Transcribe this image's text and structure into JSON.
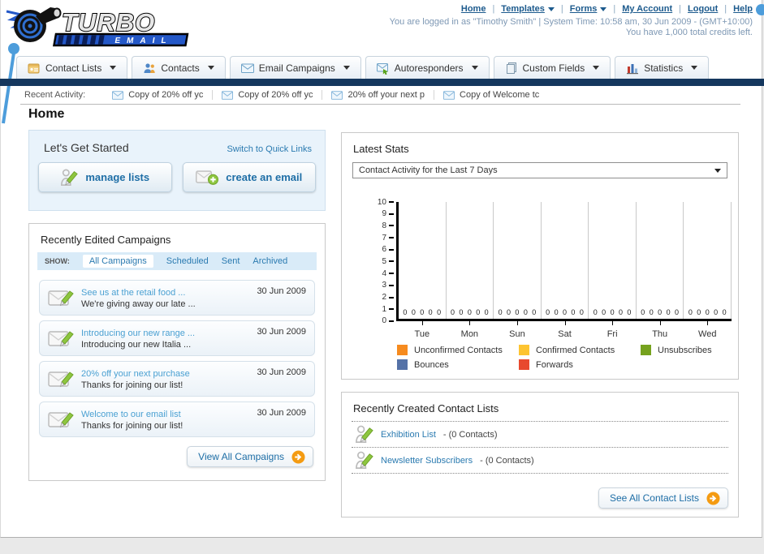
{
  "header": {
    "logo_title": "TURBO",
    "logo_subtitle": "EMAIL",
    "nav_links": [
      {
        "label": "Home",
        "dropdown": false
      },
      {
        "label": "Templates",
        "dropdown": true
      },
      {
        "label": "Forms",
        "dropdown": true
      },
      {
        "label": "My Account",
        "dropdown": false
      },
      {
        "label": "Logout",
        "dropdown": false
      },
      {
        "label": "Help",
        "dropdown": false
      }
    ],
    "login_status": "You are logged in as \"Timothy Smith\" | System Time: 10:58 am, 30 Jun 2009 - (GMT+10:00)",
    "credits": "You have 1,000 total credits left."
  },
  "nav_tabs": [
    {
      "label": "Contact Lists"
    },
    {
      "label": "Contacts"
    },
    {
      "label": "Email Campaigns"
    },
    {
      "label": "Autoresponders"
    },
    {
      "label": "Custom Fields"
    },
    {
      "label": "Statistics"
    }
  ],
  "recent_activity": {
    "label": "Recent Activity:",
    "items": [
      "Copy of 20% off yc",
      "Copy of 20% off yc",
      "20% off your next p",
      "Copy of Welcome tc"
    ]
  },
  "page_title": "Home",
  "get_started": {
    "title": "Let's Get Started",
    "switch_link": "Switch to Quick Links",
    "buttons": [
      {
        "label": "manage lists"
      },
      {
        "label": "create an email"
      }
    ]
  },
  "campaigns": {
    "title": "Recently Edited Campaigns",
    "show_label": "SHOW:",
    "filters": [
      "All Campaigns",
      "Scheduled",
      "Sent",
      "Archived"
    ],
    "items": [
      {
        "title": "See us at the retail food ...",
        "subtitle": "We're giving away our late ...",
        "date": "30 Jun 2009"
      },
      {
        "title": "Introducing our new range ...",
        "subtitle": "Introducing our new Italia ...",
        "date": "30 Jun 2009"
      },
      {
        "title": "20% off your next purchase",
        "subtitle": "Thanks for joining our list!",
        "date": "30 Jun 2009"
      },
      {
        "title": "Welcome to our email list",
        "subtitle": "Thanks for joining our list!",
        "date": "30 Jun 2009"
      }
    ],
    "view_all_label": "View All Campaigns"
  },
  "stats": {
    "title": "Latest Stats",
    "dropdown_value": "Contact Activity for the Last 7 Days"
  },
  "chart_data": {
    "type": "bar",
    "title": "Contact Activity for the Last 7 Days",
    "categories": [
      "Tue",
      "Mon",
      "Sun",
      "Sat",
      "Fri",
      "Thu",
      "Wed"
    ],
    "series": [
      {
        "name": "Unconfirmed Contacts",
        "color": "#f68b1f",
        "values": [
          0,
          0,
          0,
          0,
          0,
          0,
          0
        ]
      },
      {
        "name": "Confirmed Contacts",
        "color": "#fdc431",
        "values": [
          0,
          0,
          0,
          0,
          0,
          0,
          0
        ]
      },
      {
        "name": "Unsubscribes",
        "color": "#76a21e",
        "values": [
          0,
          0,
          0,
          0,
          0,
          0,
          0
        ]
      },
      {
        "name": "Bounces",
        "color": "#5572a7",
        "values": [
          0,
          0,
          0,
          0,
          0,
          0,
          0
        ]
      },
      {
        "name": "Forwards",
        "color": "#e8492e",
        "values": [
          0,
          0,
          0,
          0,
          0,
          0,
          0
        ]
      }
    ],
    "ylim": [
      0,
      10
    ],
    "yticks": [
      0,
      1,
      2,
      3,
      4,
      5,
      6,
      7,
      8,
      9,
      10
    ],
    "xlabel": "",
    "ylabel": "",
    "value_labels_shown": true,
    "grid": "vertical group separators",
    "legend_position": "bottom"
  },
  "contact_lists": {
    "title": "Recently Created Contact Lists",
    "items": [
      {
        "name": "Exhibition List",
        "suffix": " - (0 Contacts)"
      },
      {
        "name": "Newsletter Subscribers",
        "suffix": " - (0 Contacts)"
      }
    ],
    "see_all_label": "See All Contact Lists"
  },
  "colors": {
    "navy_bar": "#15375e",
    "header_link": "#1c5a8d",
    "status_text": "#7e98b4",
    "campaign_link": "#4aa0d2",
    "get_started_bg": "#e9f3fb",
    "filter_bar_bg": "#d9ebf8",
    "accent_orange": "#f49b12",
    "deco_blue": "#4d9ddb"
  },
  "icons": {
    "chevron-down": "▾",
    "envelope": "✉",
    "pencil": "✎",
    "arrow-right-circle": "➔",
    "plus-circle": "+"
  }
}
